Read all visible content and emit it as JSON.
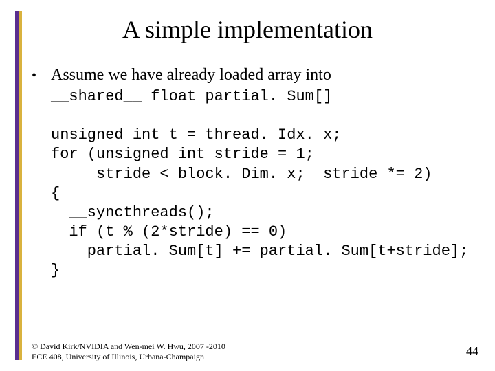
{
  "title": "A simple implementation",
  "bullet": "Assume we have already loaded array into",
  "code": {
    "l1": "__shared__ float partial. Sum[]",
    "l2": "",
    "l3": "unsigned int t = thread. Idx. x;",
    "l4": "for (unsigned int stride = 1;",
    "l5": "     stride < block. Dim. x;  stride *= 2)",
    "l6": "{",
    "l7": "  __syncthreads();",
    "l8": "  if (t % (2*stride) == 0)",
    "l9": "    partial. Sum[t] += partial. Sum[t+stride];",
    "l10": "}"
  },
  "footer_line1": "© David Kirk/NVIDIA and Wen-mei W. Hwu, 2007 -2010",
  "footer_line2": "ECE 408, University of Illinois, Urbana-Champaign",
  "page_number": "44"
}
